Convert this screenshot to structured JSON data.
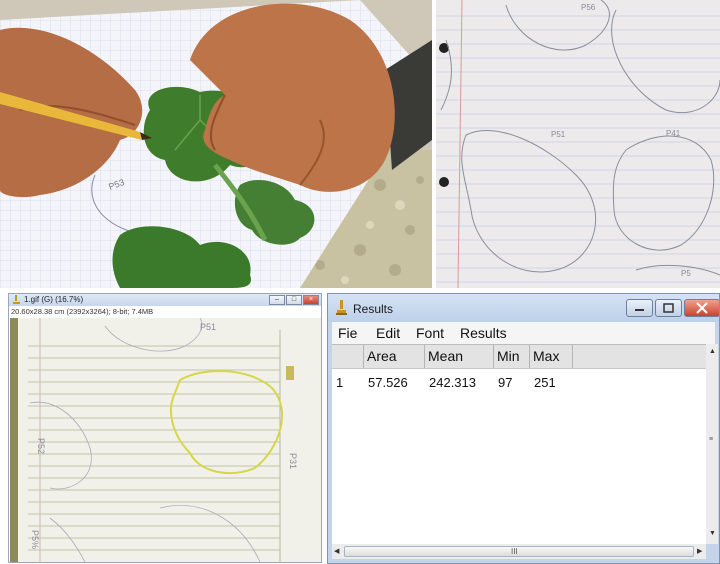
{
  "imagej_window": {
    "title": "1.gif (G) (16.7%)",
    "info": "20.60x28.38 cm (2392x3264); 8-bit; 7.4MB",
    "sketch_labels": [
      "P51",
      "P52",
      "P31",
      "P5%"
    ]
  },
  "notebook_photo": {
    "handwritten_labels": [
      "P56",
      "P51",
      "P41",
      "P5"
    ]
  },
  "results_window": {
    "title": "Results",
    "menu": [
      "Fie",
      "Edit",
      "Font",
      "Results"
    ],
    "columns": [
      "",
      "Area",
      "Mean",
      "Min",
      "Max"
    ],
    "rows": [
      {
        "index": "1",
        "Area": "57.526",
        "Mean": "242.313",
        "Min": "97",
        "Max": "251"
      }
    ],
    "scroll_grip": "III"
  },
  "colors": {
    "titlebar_blue": "#c5d4ea",
    "close_red": "#c8432c",
    "leaf_green": "#3f7d2c",
    "outline_yellow": "#d6d64a"
  }
}
